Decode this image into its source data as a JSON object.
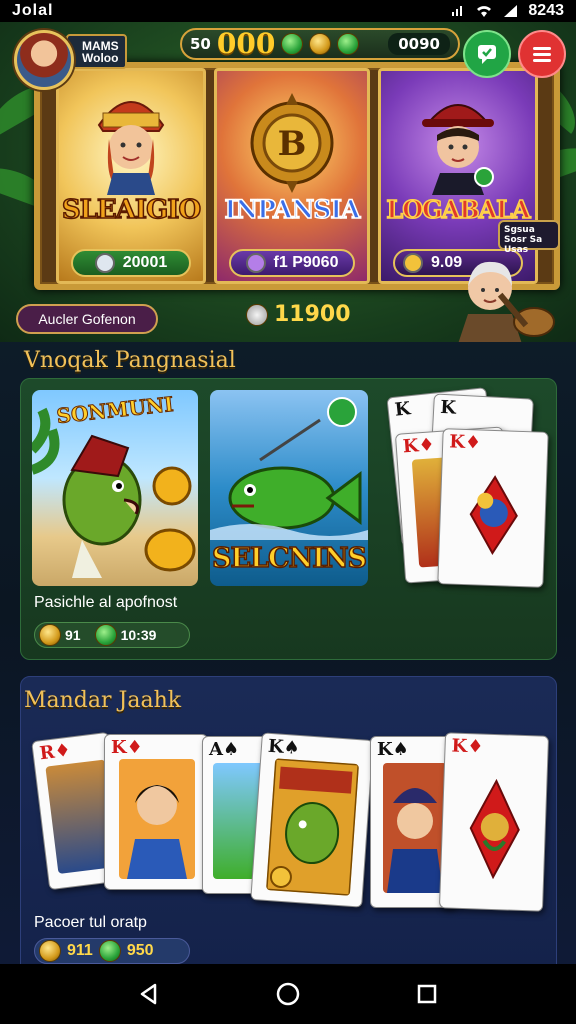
{
  "status_bar": {
    "time": "Jolal",
    "right_text": "8243"
  },
  "header": {
    "player_name_line1": "MAMS",
    "player_name_line2": "Woloo",
    "coins_left": "50",
    "coins_big": "000",
    "coins_right": "0090"
  },
  "featured_games": [
    {
      "title": "SLEAIGIO",
      "badge_value": "20001",
      "badge_icon": "trophy-icon"
    },
    {
      "title": "INPANSIA",
      "badge_value": "f1 P9060",
      "badge_icon": "gift-icon"
    },
    {
      "title": "LOGABALA",
      "badge_value": "9.09",
      "badge_icon": "coin-icon"
    }
  ],
  "speech_bubble": "Sgsua Sosr Sa Usas",
  "action_button": "Aucler Gofenon",
  "balance": "11900",
  "section1": {
    "title": "Vnoqak Pangnasial",
    "tile1_label": "SONMUNI",
    "tile2_label": "SELCNINS",
    "caption": "Pasichle al apofnost",
    "coin_a": "91",
    "coin_b": "10:39"
  },
  "section2": {
    "title": "Mandar Jaahk",
    "caption": "Pacoer tul oratp",
    "coin_a": "911",
    "coin_b": "950"
  },
  "colors": {
    "accent_gold": "#f1c15a",
    "chat_button": "#21a545",
    "menu_button": "#e03232"
  }
}
